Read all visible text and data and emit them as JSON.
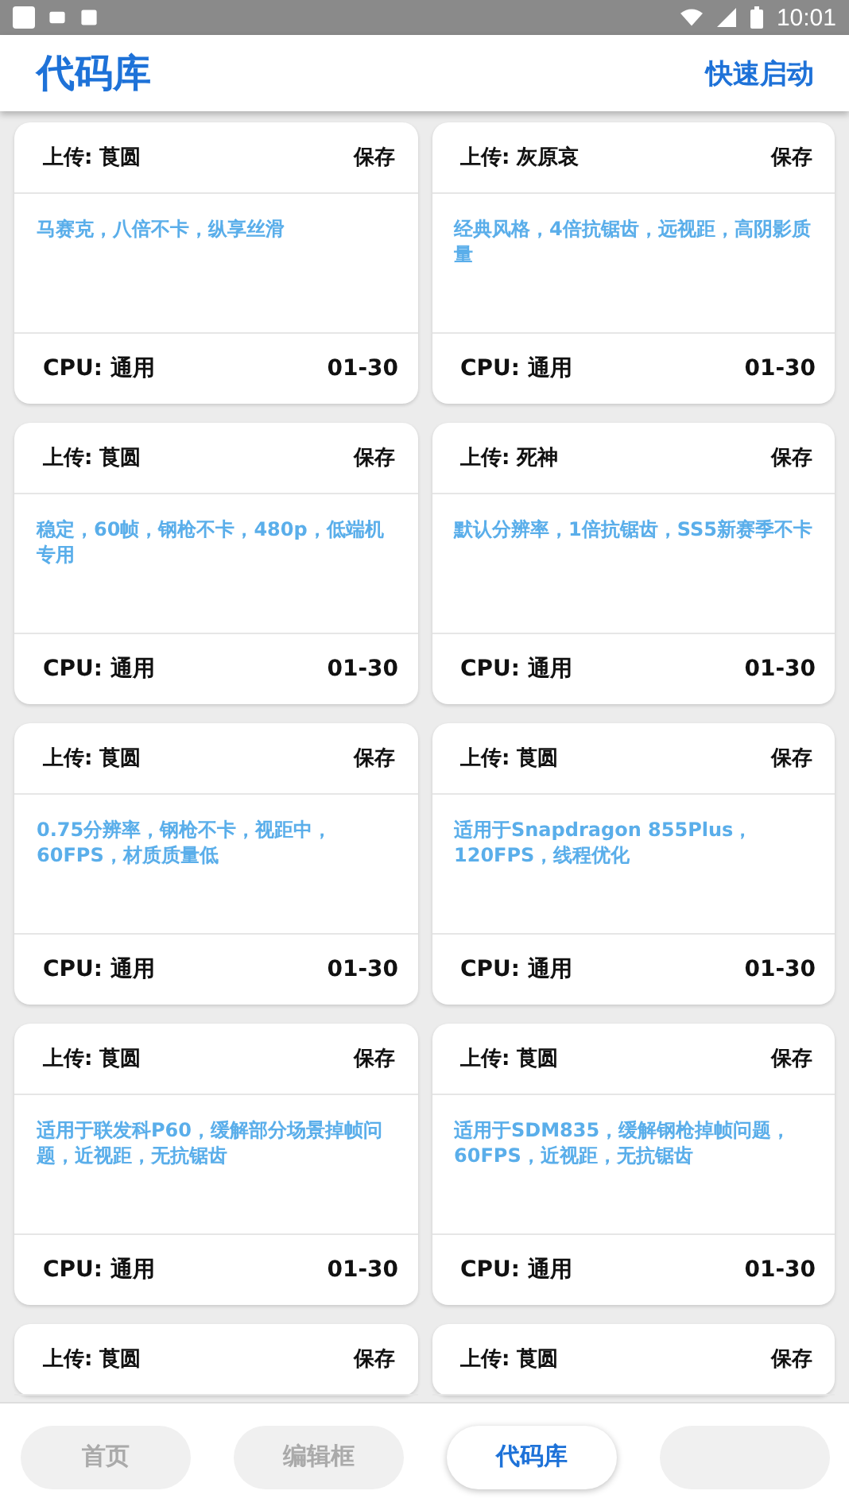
{
  "status_bar": {
    "time": "10:01"
  },
  "header": {
    "title": "代码库",
    "action": "快速启动"
  },
  "columns": [
    [
      {
        "uploader": "上传: 莨圆",
        "save": "保存",
        "description": "马赛克，八倍不卡，纵享丝滑",
        "cpu": "CPU: 通用",
        "date": "01-30"
      },
      {
        "uploader": "上传: 莨圆",
        "save": "保存",
        "description": "稳定，60帧，钢枪不卡，480p，低端机专用",
        "cpu": "CPU: 通用",
        "date": "01-30"
      },
      {
        "uploader": "上传: 莨圆",
        "save": "保存",
        "description": "0.75分辨率，钢枪不卡，视距中，60FPS，材质质量低",
        "cpu": "CPU: 通用",
        "date": "01-30"
      },
      {
        "uploader": "上传: 莨圆",
        "save": "保存",
        "description": "适用于联发科P60，缓解部分场景掉帧问题，近视距，无抗锯齿",
        "cpu": "CPU: 通用",
        "date": "01-30"
      },
      {
        "uploader": "上传: 莨圆",
        "save": "保存"
      }
    ],
    [
      {
        "uploader": "上传: 灰原哀",
        "save": "保存",
        "description": "经典风格，4倍抗锯齿，远视距，高阴影质量",
        "cpu": "CPU: 通用",
        "date": "01-30"
      },
      {
        "uploader": "上传: 死神",
        "save": "保存",
        "description": "默认分辨率，1倍抗锯齿，SS5新赛季不卡",
        "cpu": "CPU: 通用",
        "date": "01-30"
      },
      {
        "uploader": "上传: 莨圆",
        "save": "保存",
        "description": "适用于Snapdragon 855Plus，120FPS，线程优化",
        "cpu": "CPU: 通用",
        "date": "01-30"
      },
      {
        "uploader": "上传: 莨圆",
        "save": "保存",
        "description": "适用于SDM835，缓解钢枪掉帧问题，60FPS，近视距，无抗锯齿",
        "cpu": "CPU: 通用",
        "date": "01-30"
      },
      {
        "uploader": "上传: 莨圆",
        "save": "保存"
      }
    ]
  ],
  "bottom_nav": [
    {
      "label": "首页",
      "selected": false
    },
    {
      "label": "编辑框",
      "selected": false
    },
    {
      "label": "代码库",
      "selected": true
    },
    {
      "selected": false
    }
  ]
}
